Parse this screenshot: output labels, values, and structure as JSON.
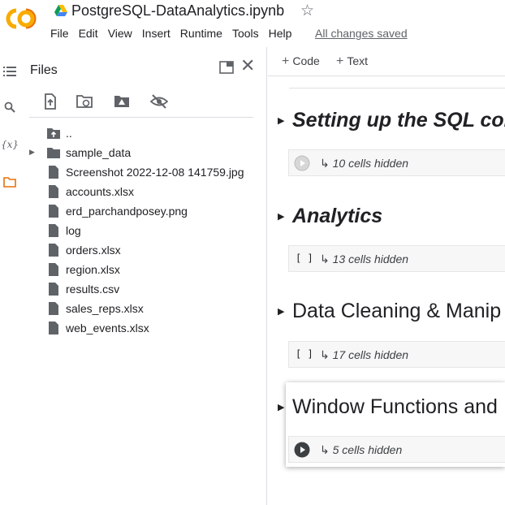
{
  "header": {
    "logo_text": "CO",
    "title": "PostgreSQL-DataAnalytics.ipynb",
    "menu": [
      "File",
      "Edit",
      "View",
      "Insert",
      "Runtime",
      "Tools",
      "Help"
    ],
    "save_status": "All changes saved",
    "icons": {
      "drive": "google-drive-icon",
      "star": "star-icon"
    }
  },
  "rail": {
    "icons": [
      "toc-icon",
      "search-icon",
      "variables-icon",
      "folder-icon"
    ],
    "variables_glyph": "{x}"
  },
  "files": {
    "title": "Files",
    "toolbar": [
      "upload-icon",
      "refresh-icon",
      "mount-drive-icon",
      "hide-icon"
    ],
    "tree": [
      {
        "label": "..",
        "icon": "folder-up-icon",
        "caret": false
      },
      {
        "label": "sample_data",
        "icon": "folder-icon",
        "caret": true
      },
      {
        "label": "Screenshot 2022-12-08 141759.jpg",
        "icon": "file-icon",
        "caret": false
      },
      {
        "label": "accounts.xlsx",
        "icon": "file-icon",
        "caret": false
      },
      {
        "label": "erd_parchandposey.png",
        "icon": "file-icon",
        "caret": false
      },
      {
        "label": "log",
        "icon": "file-icon",
        "caret": false
      },
      {
        "label": "orders.xlsx",
        "icon": "file-icon",
        "caret": false
      },
      {
        "label": "region.xlsx",
        "icon": "file-icon",
        "caret": false
      },
      {
        "label": "results.csv",
        "icon": "file-icon",
        "caret": false
      },
      {
        "label": "sales_reps.xlsx",
        "icon": "file-icon",
        "caret": false
      },
      {
        "label": "web_events.xlsx",
        "icon": "file-icon",
        "caret": false
      }
    ]
  },
  "notebook": {
    "toolbar": {
      "code_label": "Code",
      "text_label": "Text"
    },
    "sections": [
      {
        "title": "Setting up the SQL con",
        "hidden": "10 cells hidden",
        "style": "bold-italic",
        "run": "run-gray-icon"
      },
      {
        "title": "Analytics",
        "hidden": "13 cells hidden",
        "style": "bold-italic",
        "run": "brackets"
      },
      {
        "title": "Data Cleaning & Manip",
        "hidden": "17 cells hidden",
        "style": "normal",
        "run": "brackets"
      },
      {
        "title": "Window Functions and",
        "hidden": "5 cells hidden",
        "style": "normal",
        "run": "run-dark-icon"
      }
    ],
    "brackets_text": "[ ]",
    "hidden_glyph": "↳"
  }
}
